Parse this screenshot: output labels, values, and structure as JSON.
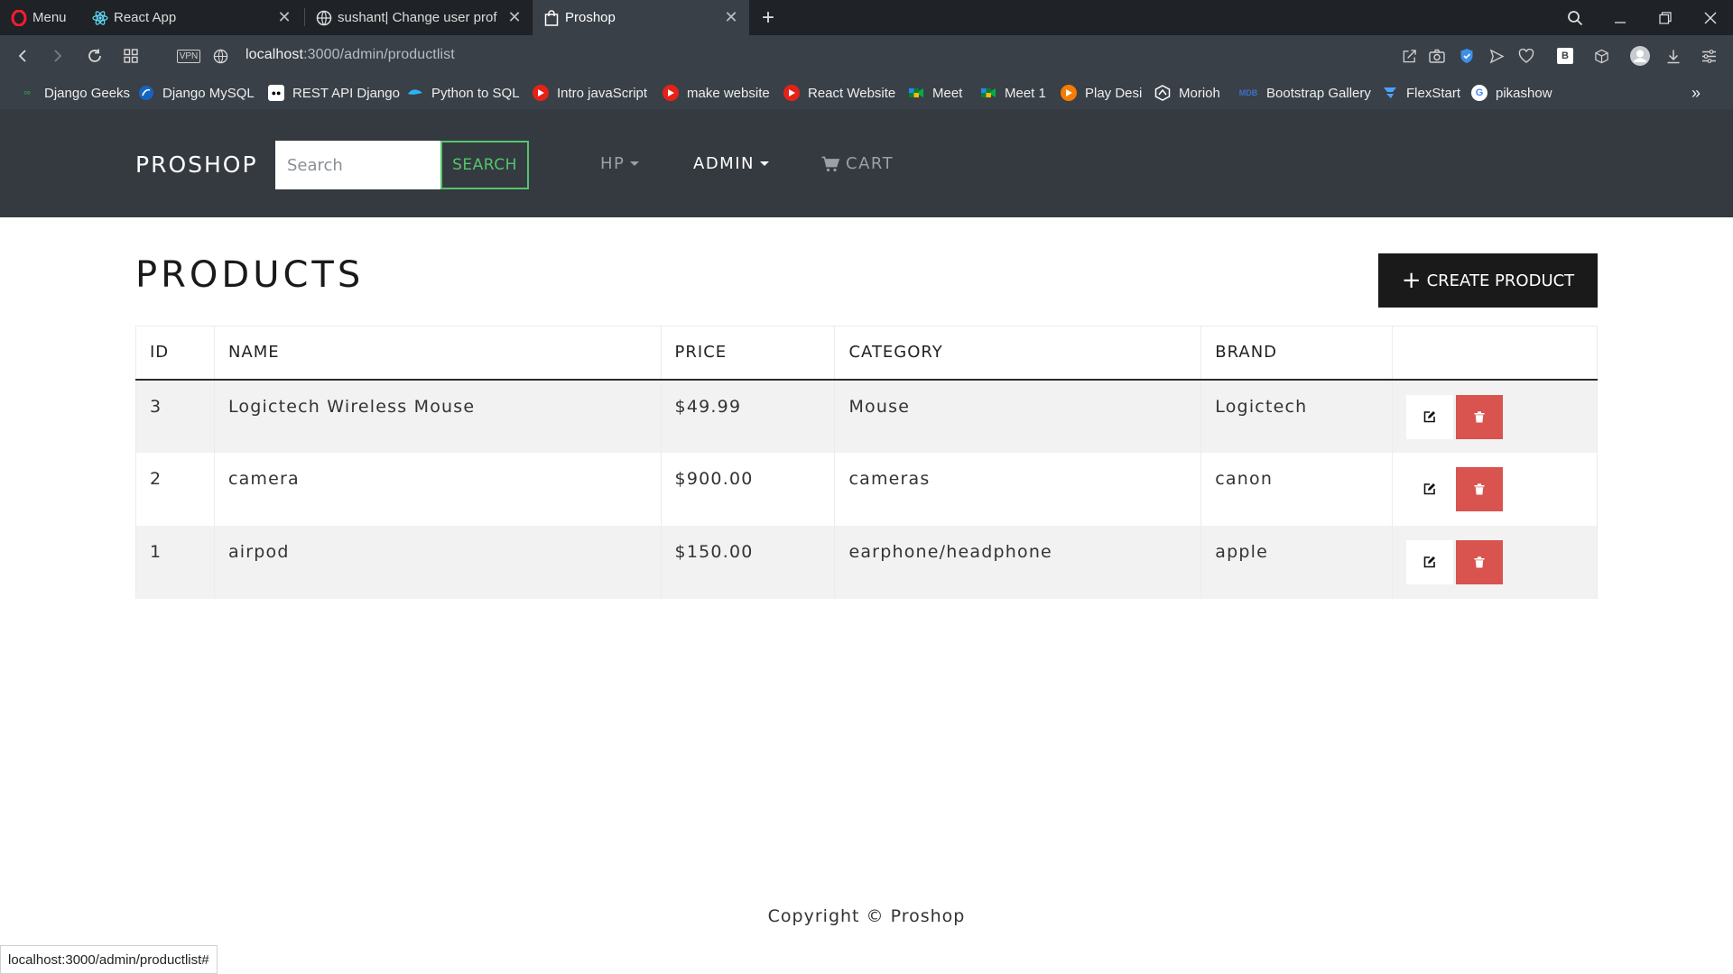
{
  "browser": {
    "menu_label": "Menu",
    "tabs": [
      {
        "title": "React App"
      },
      {
        "title": "sushant| Change user prof"
      },
      {
        "title": "Proshop"
      }
    ],
    "url_host": "localhost",
    "url_path": ":3000/admin/productlist",
    "vpn_label": "VPN",
    "bookmarks": [
      {
        "label": "Django Geeks"
      },
      {
        "label": "Django MySQL"
      },
      {
        "label": "REST API Django"
      },
      {
        "label": "Python to SQL"
      },
      {
        "label": "Intro javaScript"
      },
      {
        "label": "make website"
      },
      {
        "label": "React Website"
      },
      {
        "label": "Meet"
      },
      {
        "label": "Meet 1"
      },
      {
        "label": "Play Desi"
      },
      {
        "label": "Morioh"
      },
      {
        "label": "Bootstrap Gallery"
      },
      {
        "label": "FlexStart"
      },
      {
        "label": "pikashow"
      }
    ],
    "status_url": "localhost:3000/admin/productlist#"
  },
  "navbar": {
    "brand": "PROSHOP",
    "search_placeholder": "Search",
    "search_button": "SEARCH",
    "user_menu": "HP",
    "admin_menu": "ADMIN",
    "cart": "CART"
  },
  "main": {
    "title": "PRODUCTS",
    "create_button": "CREATE PRODUCT",
    "table": {
      "headers": [
        "ID",
        "NAME",
        "PRICE",
        "CATEGORY",
        "BRAND",
        ""
      ],
      "rows": [
        {
          "id": "3",
          "name": "Logictech Wireless Mouse",
          "price": "$49.99",
          "category": "Mouse",
          "brand": "Logictech"
        },
        {
          "id": "2",
          "name": "camera",
          "price": "$900.00",
          "category": "cameras",
          "brand": "canon"
        },
        {
          "id": "1",
          "name": "airpod",
          "price": "$150.00",
          "category": "earphone/headphone",
          "brand": "apple"
        }
      ]
    }
  },
  "footer": {
    "copyright": "Copyright © Proshop"
  },
  "colors": {
    "navbar_bg": "#343a40",
    "search_accent": "#55c46c",
    "delete_red": "#d9534f",
    "create_btn_bg": "#1a1a1a"
  }
}
